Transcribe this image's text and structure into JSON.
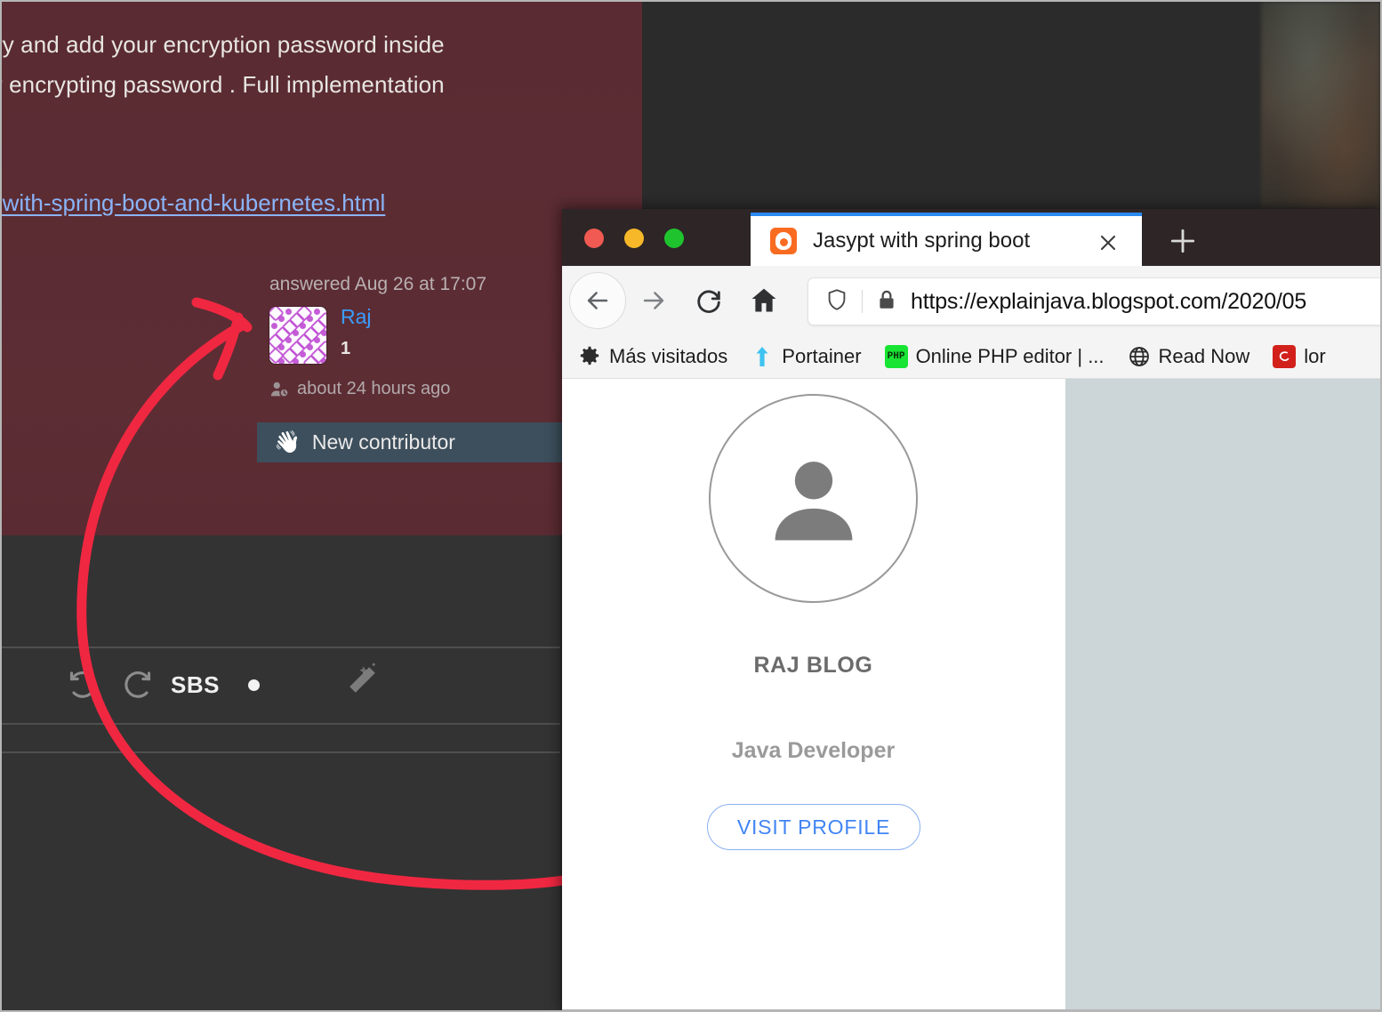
{
  "background_page": {
    "post_text_line1": "ry and add your encryption password inside",
    "post_text_line2": "r encrypting password . Full implementation",
    "link_text": "-with-spring-boot-and-kubernetes.html",
    "answered_meta": "answered Aug 26 at 17:07",
    "user_name": "Raj",
    "user_reputation": "1",
    "activity_time": "about 24 hours ago",
    "badge_label": "New contributor",
    "badge_icon": "waving-hand-icon",
    "maroon_color": "#5c2c33",
    "badge_color": "#3d4f5c",
    "link_color": "#8ab4f8",
    "username_color": "#3b9cff"
  },
  "editor_toolbar": {
    "undo_icon": "undo-icon",
    "redo_icon": "redo-icon",
    "mode_label": "SBS",
    "dot_indicator": "dot-indicator",
    "magic_wand_icon": "magic-wand-icon"
  },
  "annotation": {
    "arrow_color": "#f02741",
    "description": "red curved arrow"
  },
  "browser": {
    "window_controls": {
      "close_color": "#f05a52",
      "minimize_color": "#f6b829",
      "maximize_color": "#1fc32e"
    },
    "tab": {
      "title": "Jasypt with spring boot",
      "favicon": "blogger-icon",
      "favicon_color": "#f96b20",
      "close_icon": "close-icon",
      "active_indicator_color": "#2a8af0"
    },
    "new_tab_icon": "plus-icon",
    "nav": {
      "back_icon": "arrow-left-icon",
      "forward_icon": "arrow-right-icon",
      "reload_icon": "reload-icon",
      "home_icon": "home-icon"
    },
    "address_bar": {
      "shield_icon": "shield-icon",
      "lock_icon": "lock-icon",
      "url": "https://explainjava.blogspot.com/2020/05"
    },
    "bookmarks": [
      {
        "label": "Más visitados",
        "icon": "gear-icon",
        "color": "#2b2b2b"
      },
      {
        "label": "Portainer",
        "icon": "up-arrow-icon",
        "color": "#3fc3f0"
      },
      {
        "label": "Online PHP editor | ...",
        "icon": "php-icon",
        "color": "#18e533"
      },
      {
        "label": "Read Now",
        "icon": "globe-icon",
        "color": "#2b2b2b"
      },
      {
        "label": "lor",
        "icon": "lorem-icon",
        "color": "#d2211b"
      }
    ],
    "page": {
      "avatar_icon": "person-avatar-icon",
      "blog_title": "RAJ BLOG",
      "blog_subtitle": "Java Developer",
      "visit_profile_label": "VISIT PROFILE",
      "sidebar_color": "#ccd5d8",
      "link_color": "#4285f4"
    }
  }
}
